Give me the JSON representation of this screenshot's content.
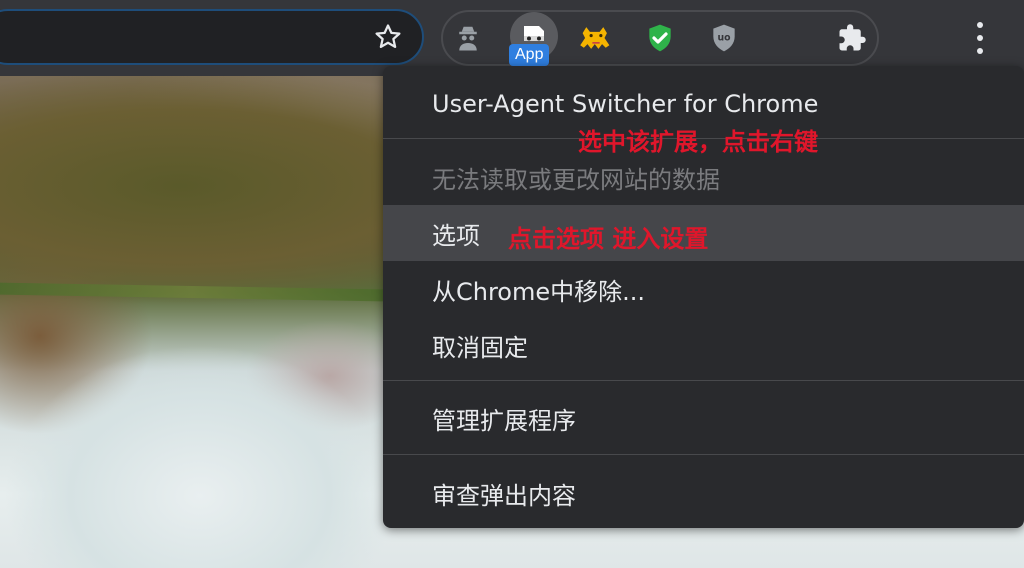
{
  "toolbar": {
    "star_icon": "star-outline-icon",
    "extensions": [
      {
        "name": "incognito-spy-extension",
        "icon": "spy-icon"
      },
      {
        "name": "user-agent-switcher-extension",
        "icon": "user-agent-icon",
        "badge": "App"
      },
      {
        "name": "tampermonkey-cat-extension",
        "icon": "cat-icon"
      },
      {
        "name": "shield-check-extension",
        "icon": "green-shield-check-icon"
      },
      {
        "name": "ublock-origin-extension",
        "icon": "ublock-shield-icon",
        "label": "uo"
      },
      {
        "name": "extensions-puzzle",
        "icon": "puzzle-icon"
      }
    ],
    "menu_icon": "vertical-dots-icon"
  },
  "context_menu": {
    "title": "User-Agent Switcher for Chrome",
    "disabled_item": "无法读取或更改网站的数据",
    "items": [
      {
        "label": "选项"
      },
      {
        "label": "从Chrome中移除..."
      },
      {
        "label": "取消固定"
      },
      {
        "label": "管理扩展程序"
      },
      {
        "label": "审查弹出内容"
      }
    ]
  },
  "annotations": {
    "select_extension": "选中该扩展，点击右键",
    "click_options": "点击选项 进入设置"
  },
  "colors": {
    "annotation": "#e0162b",
    "menu_bg": "#292a2d",
    "toolbar_bg": "#35363a",
    "badge": "#2f7fe0"
  }
}
